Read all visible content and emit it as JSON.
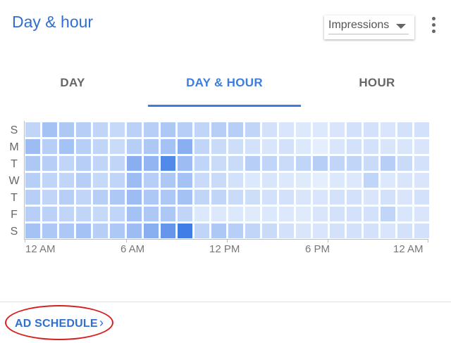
{
  "header": {
    "title": "Day & hour",
    "metric": "Impressions"
  },
  "tabs": [
    {
      "label": "DAY"
    },
    {
      "label": "DAY & HOUR"
    },
    {
      "label": "HOUR"
    }
  ],
  "active_tab": "DAY & HOUR",
  "footer": {
    "link_label": "AD SCHEDULE",
    "chevron": "›"
  },
  "chart_data": {
    "type": "heatmap",
    "metric": "Impressions",
    "y_categories": [
      "S",
      "M",
      "T",
      "W",
      "T",
      "F",
      "S"
    ],
    "x_categories": [
      "12 AM",
      "1 AM",
      "2 AM",
      "3 AM",
      "4 AM",
      "5 AM",
      "6 AM",
      "7 AM",
      "8 AM",
      "9 AM",
      "10 AM",
      "11 AM",
      "12 PM",
      "1 PM",
      "2 PM",
      "3 PM",
      "4 PM",
      "5 PM",
      "6 PM",
      "7 PM",
      "8 PM",
      "9 PM",
      "10 PM",
      "11 PM"
    ],
    "x_tick_labels": [
      "12 AM",
      "6 AM",
      "12 PM",
      "6 PM",
      "12 AM"
    ],
    "intensity_scale": [
      0,
      1
    ],
    "values": [
      [
        0.25,
        0.4,
        0.35,
        0.3,
        0.25,
        0.22,
        0.28,
        0.3,
        0.35,
        0.3,
        0.25,
        0.3,
        0.3,
        0.25,
        0.15,
        0.12,
        0.1,
        0.1,
        0.12,
        0.15,
        0.15,
        0.12,
        0.15,
        0.15
      ],
      [
        0.45,
        0.3,
        0.4,
        0.3,
        0.25,
        0.2,
        0.3,
        0.35,
        0.4,
        0.55,
        0.25,
        0.2,
        0.18,
        0.15,
        0.12,
        0.15,
        0.1,
        0.05,
        0.12,
        0.15,
        0.15,
        0.12,
        0.12,
        0.12
      ],
      [
        0.35,
        0.3,
        0.25,
        0.3,
        0.25,
        0.25,
        0.55,
        0.5,
        0.85,
        0.45,
        0.25,
        0.2,
        0.2,
        0.3,
        0.25,
        0.2,
        0.25,
        0.3,
        0.25,
        0.25,
        0.2,
        0.3,
        0.2,
        0.15
      ],
      [
        0.3,
        0.25,
        0.25,
        0.3,
        0.22,
        0.25,
        0.45,
        0.3,
        0.35,
        0.4,
        0.2,
        0.2,
        0.15,
        0.1,
        0.12,
        0.1,
        0.08,
        0.05,
        0.1,
        0.1,
        0.25,
        0.1,
        0.12,
        0.12
      ],
      [
        0.3,
        0.25,
        0.3,
        0.25,
        0.3,
        0.35,
        0.45,
        0.35,
        0.35,
        0.4,
        0.25,
        0.25,
        0.2,
        0.18,
        0.15,
        0.15,
        0.12,
        0.12,
        0.15,
        0.15,
        0.12,
        0.15,
        0.12,
        0.15
      ],
      [
        0.3,
        0.28,
        0.25,
        0.25,
        0.22,
        0.25,
        0.4,
        0.35,
        0.35,
        0.25,
        0.1,
        0.1,
        0.1,
        0.08,
        0.1,
        0.1,
        0.08,
        0.12,
        0.15,
        0.15,
        0.15,
        0.25,
        0.12,
        0.12
      ],
      [
        0.4,
        0.35,
        0.35,
        0.4,
        0.3,
        0.35,
        0.45,
        0.55,
        0.75,
        0.95,
        0.25,
        0.35,
        0.3,
        0.25,
        0.2,
        0.15,
        0.12,
        0.12,
        0.15,
        0.15,
        0.15,
        0.12,
        0.15,
        0.15
      ]
    ]
  },
  "colors": {
    "accent": "#3b7de0",
    "cell_light": "#eef4fd",
    "cell_dark": "#3777e6",
    "annotation_oval": "#d61f1f"
  }
}
